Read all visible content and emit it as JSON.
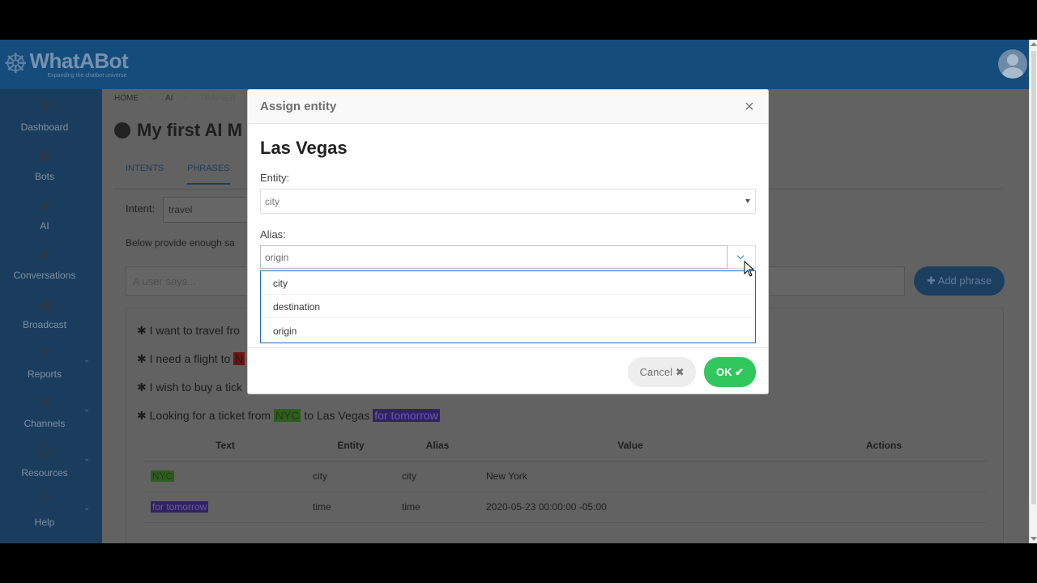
{
  "app": {
    "name": "WhatABot",
    "tagline": "Expanding the chatbot universe"
  },
  "sidebar": {
    "items": [
      {
        "label": "Dashboard",
        "icon": "dashboard-icon",
        "glyph": "▼",
        "caret": false
      },
      {
        "label": "Bots",
        "icon": "bot-icon",
        "glyph": "■",
        "caret": false
      },
      {
        "label": "AI",
        "icon": "brain-icon",
        "glyph": "●",
        "caret": false
      },
      {
        "label": "Conversations",
        "icon": "chat-bubbles-icon",
        "glyph": "●",
        "caret": false
      },
      {
        "label": "Broadcast",
        "icon": "megaphone-icon",
        "glyph": "◀",
        "caret": false
      },
      {
        "label": "Reports",
        "icon": "line-chart-icon",
        "glyph": "↗",
        "caret": true
      },
      {
        "label": "Channels",
        "icon": "network-icon",
        "glyph": "✕",
        "caret": true
      },
      {
        "label": "Resources",
        "icon": "gear-icon",
        "glyph": "⚙",
        "caret": true
      },
      {
        "label": "Help",
        "icon": "help-icon",
        "glyph": "?",
        "caret": true
      }
    ]
  },
  "main": {
    "breadcrumb": [
      "HOME",
      "AI",
      "TRAINER"
    ],
    "title": "My first AI M",
    "tabs": [
      "INTENTS",
      "PHRASES"
    ],
    "intent_label": "Intent:",
    "intent_value": "travel",
    "below_text": "Below provide enough sa",
    "user_says_placeholder": "A user says...",
    "add_phrase_label": "Add phrase",
    "phrases": [
      {
        "prefix": "I want to travel fro",
        "highlight": "",
        "suffix": ""
      },
      {
        "prefix": "I need a flight to ",
        "highlight": "N",
        "suffix": ""
      },
      {
        "prefix": "I wish to buy a tick",
        "highlight": "",
        "suffix": ""
      },
      {
        "prefix": "Looking for a ticket from ",
        "highlight": "NYC",
        "middle": " to Las Vegas ",
        "highlight2": "for tomorrow"
      }
    ],
    "table": {
      "headers": [
        "Text",
        "Entity",
        "Alias",
        "Value",
        "Actions"
      ],
      "rows": [
        {
          "text": "NYC",
          "entity": "city",
          "alias": "city",
          "value": "New York",
          "color": "green"
        },
        {
          "text": "for tomorrow",
          "entity": "time",
          "alias": "time",
          "value": "2020-05-23 00:00:00 -05:00",
          "color": "purple"
        }
      ]
    }
  },
  "modal": {
    "title": "Assign entity",
    "heading": "Las Vegas",
    "entity_label": "Entity:",
    "entity_value": "city",
    "alias_label": "Alias:",
    "alias_value": "origin",
    "alias_options": [
      "city",
      "destination",
      "origin"
    ],
    "cancel_label": "Cancel",
    "ok_label": "OK"
  },
  "colors": {
    "topbar": "#144c7c",
    "sidebar": "#1b3d5d",
    "ok_button": "#31c75d",
    "dropdown_border": "#1f6fbf"
  }
}
